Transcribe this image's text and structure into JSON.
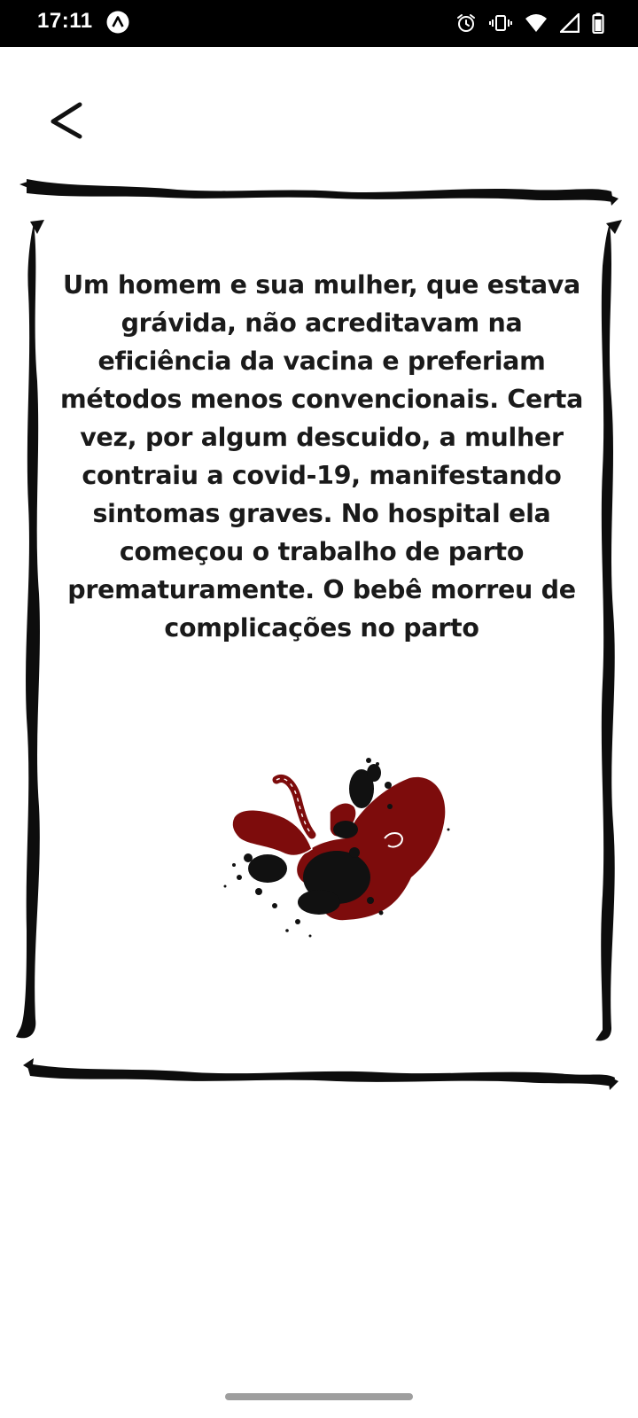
{
  "status_bar": {
    "time": "17:11",
    "icons": [
      "app-a-icon",
      "alarm-icon",
      "vibrate-icon",
      "wifi-icon",
      "signal-icon",
      "battery-icon"
    ]
  },
  "header": {
    "back_icon": "chevron-left-icon"
  },
  "story": {
    "text": "Um homem e sua mulher, que estava grávida, não acreditavam na eficiência da vacina e preferiam métodos menos convencionais. Certa vez, por algum descuido, a mulher contraiu a covid-19, manifestando sintomas graves. No hospital ela começou o trabalho de parto prematuramente. O bebê morreu de complicações no parto"
  },
  "illustration": {
    "subject": "fetus-illustration",
    "colors": {
      "fetus": "#7d0c0c",
      "ink": "#111111",
      "outline": "#ffffff"
    }
  },
  "colors": {
    "status_bar": "#000000",
    "background": "#ffffff",
    "text": "#1a1a1a",
    "frame": "#0d0d0d",
    "nav_handle": "#9e9e9e"
  }
}
